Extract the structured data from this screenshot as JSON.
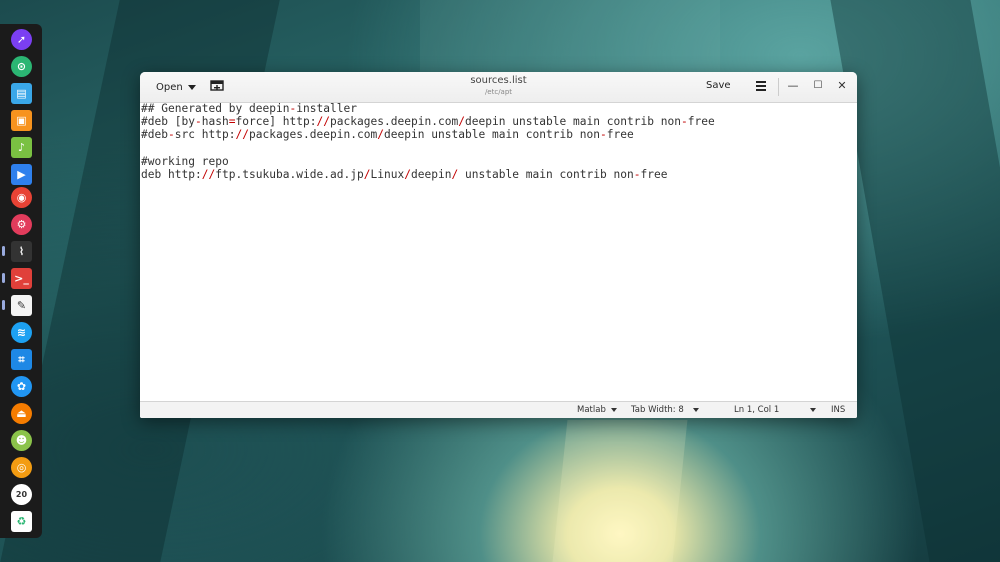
{
  "window": {
    "title": "sources.list",
    "subtitle": "/etc/apt",
    "open_label": "Open",
    "save_label": "Save",
    "minimize_glyph": "—",
    "maximize_glyph": "☐",
    "close_glyph": "✕"
  },
  "editor": {
    "lines": [
      "## Generated by deepin-installer",
      "#deb [by-hash=force] http://packages.deepin.com/deepin unstable main contrib non-free",
      "#deb-src http://packages.deepin.com/deepin unstable main contrib non-free",
      "",
      "#working repo",
      "deb http://ftp.tsukuba.wide.ad.jp/Linux/deepin/ unstable main contrib non-free"
    ]
  },
  "statusbar": {
    "language": "Matlab",
    "tab_width": "Tab Width: 8",
    "position": "Ln 1, Col 1",
    "mode": "INS"
  },
  "dock": {
    "items": [
      {
        "icon": "launcher-icon",
        "color": "#7b3ff2"
      },
      {
        "icon": "store-icon",
        "color": "#2bb673"
      },
      {
        "icon": "file-manager-icon",
        "color": "#3aa7e8"
      },
      {
        "icon": "shopping-icon",
        "color": "#f7931e"
      },
      {
        "icon": "music-icon",
        "color": "#7ac142"
      },
      {
        "icon": "video-icon",
        "color": "#2f80ed"
      },
      {
        "icon": "chrome-icon",
        "color": "#e84335"
      },
      {
        "icon": "settings-icon",
        "color": "#e23c5c"
      },
      {
        "icon": "system-monitor-icon",
        "color": "#333333"
      },
      {
        "icon": "terminal-icon",
        "color": "#e0403a"
      },
      {
        "icon": "text-editor-icon",
        "color": "#f4f4f4"
      },
      {
        "icon": "wifi-icon",
        "color": "#1da1f2"
      },
      {
        "icon": "screenshot-icon",
        "color": "#1e88e5"
      },
      {
        "icon": "app-icon",
        "color": "#2196f3"
      },
      {
        "icon": "eject-icon",
        "color": "#f57c00"
      },
      {
        "icon": "android-icon",
        "color": "#8bc34a"
      },
      {
        "icon": "ubuntu-icon",
        "color": "#f39c12"
      },
      {
        "icon": "calendar-icon",
        "color": "#ffffff"
      },
      {
        "icon": "trash-icon",
        "color": "#ffffff"
      }
    ]
  }
}
